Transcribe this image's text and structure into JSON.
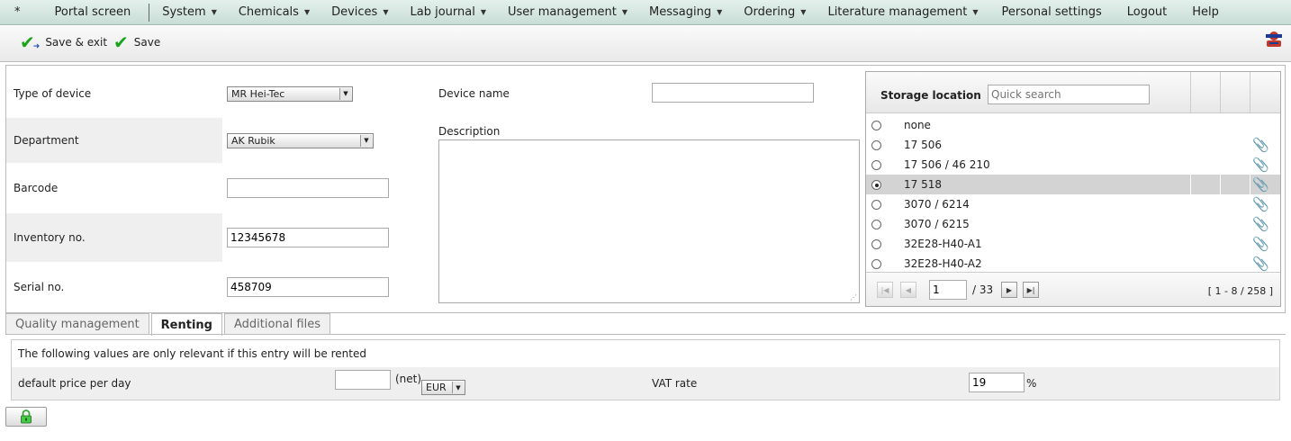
{
  "menu": {
    "star": "*",
    "items": [
      {
        "label": "Portal screen",
        "arrow": false
      },
      {
        "label": "System",
        "arrow": true
      },
      {
        "label": "Chemicals",
        "arrow": true
      },
      {
        "label": "Devices",
        "arrow": true
      },
      {
        "label": "Lab journal",
        "arrow": true
      },
      {
        "label": "User management",
        "arrow": true
      },
      {
        "label": "Messaging",
        "arrow": true
      },
      {
        "label": "Ordering",
        "arrow": true
      },
      {
        "label": "Literature management",
        "arrow": true
      },
      {
        "label": "Personal settings",
        "arrow": false
      },
      {
        "label": "Logout",
        "arrow": false
      },
      {
        "label": "Help",
        "arrow": false
      }
    ]
  },
  "toolbar": {
    "save_exit": "Save & exit",
    "save": "Save"
  },
  "form": {
    "type_label": "Type of device",
    "type_value": "MR Hei-Tec",
    "department_label": "Department",
    "department_value": "AK Rubik",
    "barcode_label": "Barcode",
    "barcode_value": "",
    "inventory_label": "Inventory no.",
    "inventory_value": "12345678",
    "serial_label": "Serial no.",
    "serial_value": "458709",
    "device_name_label": "Device name",
    "device_name_value": "",
    "description_label": "Description"
  },
  "storage": {
    "title": "Storage location",
    "search_placeholder": "Quick search",
    "items": [
      {
        "name": "none",
        "selected": false,
        "clip": false
      },
      {
        "name": "17 506",
        "selected": false,
        "clip": true
      },
      {
        "name": "17 506 / 46 210",
        "selected": false,
        "clip": true
      },
      {
        "name": "17 518",
        "selected": true,
        "clip": true
      },
      {
        "name": "3070 / 6214",
        "selected": false,
        "clip": true
      },
      {
        "name": "3070 / 6215",
        "selected": false,
        "clip": true
      },
      {
        "name": "32E28-H40-A1",
        "selected": false,
        "clip": true
      },
      {
        "name": "32E28-H40-A2",
        "selected": false,
        "clip": true
      }
    ],
    "page": "1",
    "page_of": "/ 33",
    "range": "[ 1 - 8 / 258 ]"
  },
  "tabs": [
    {
      "label": "Quality management",
      "active": false
    },
    {
      "label": "Renting",
      "active": true
    },
    {
      "label": "Additional files",
      "active": false
    }
  ],
  "renting": {
    "note": "The following values are only relevant if this entry will be rented",
    "price_label": "default price per day",
    "price_value": "",
    "net": "(net)",
    "currency": "EUR",
    "vat_label": "VAT rate",
    "vat_value": "19",
    "percent": "%"
  },
  "colors": {
    "menu_bg": "#c9ddd6",
    "check_green": "#1aa31a",
    "selected_row": "#d3d3d3"
  }
}
